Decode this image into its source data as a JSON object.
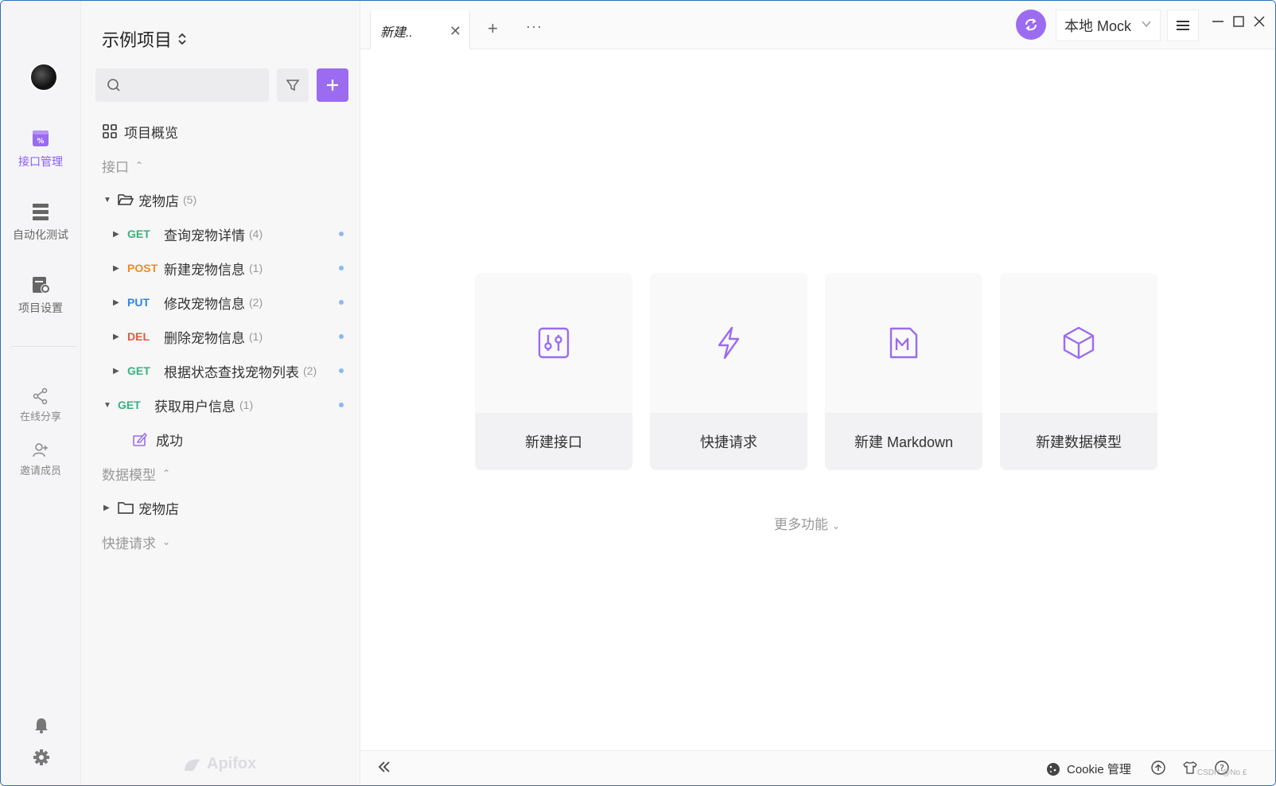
{
  "colors": {
    "accent": "#9b6cf0",
    "get": "#34b27b",
    "post": "#f08a24",
    "put": "#2f86e9",
    "del": "#e8563e"
  },
  "rail": {
    "items": [
      {
        "label": "接口管理",
        "icon": "api-icon"
      },
      {
        "label": "自动化测试",
        "icon": "test-icon"
      },
      {
        "label": "项目设置",
        "icon": "settings-doc-icon"
      }
    ],
    "share_label": "在线分享",
    "invite_label": "邀请成员"
  },
  "sidebar": {
    "project_title": "示例项目",
    "search_placeholder": "",
    "overview_label": "项目概览",
    "api_section": "接口",
    "folder": {
      "name": "宠物店",
      "count": "(5)"
    },
    "endpoints": [
      {
        "method": "GET",
        "name": "查询宠物详情",
        "count": "(4)"
      },
      {
        "method": "POST",
        "name": "新建宠物信息",
        "count": "(1)"
      },
      {
        "method": "PUT",
        "name": "修改宠物信息",
        "count": "(2)"
      },
      {
        "method": "DEL",
        "name": "删除宠物信息",
        "count": "(1)"
      },
      {
        "method": "GET",
        "name": "根据状态查找宠物列表",
        "count": "(2)"
      }
    ],
    "user_endpoint": {
      "method": "GET",
      "name": "获取用户信息",
      "count": "(1)"
    },
    "case_name": "成功",
    "models_section": "数据模型",
    "models_folder": "宠物店",
    "quick_section": "快捷请求",
    "brand": "Apifox"
  },
  "tabs": {
    "active_tab": "新建..",
    "close": "✕",
    "add": "+",
    "more": "···"
  },
  "toolbar": {
    "env_label": "本地 Mock"
  },
  "cards": [
    {
      "label": "新建接口",
      "icon": "api-doc-icon"
    },
    {
      "label": "快捷请求",
      "icon": "lightning-icon"
    },
    {
      "label": "新建 Markdown",
      "icon": "markdown-icon"
    },
    {
      "label": "新建数据模型",
      "icon": "cube-icon"
    }
  ],
  "more_features": "更多功能",
  "statusbar": {
    "cookie_label": "Cookie 管理",
    "watermark": "CSDN @No £"
  }
}
